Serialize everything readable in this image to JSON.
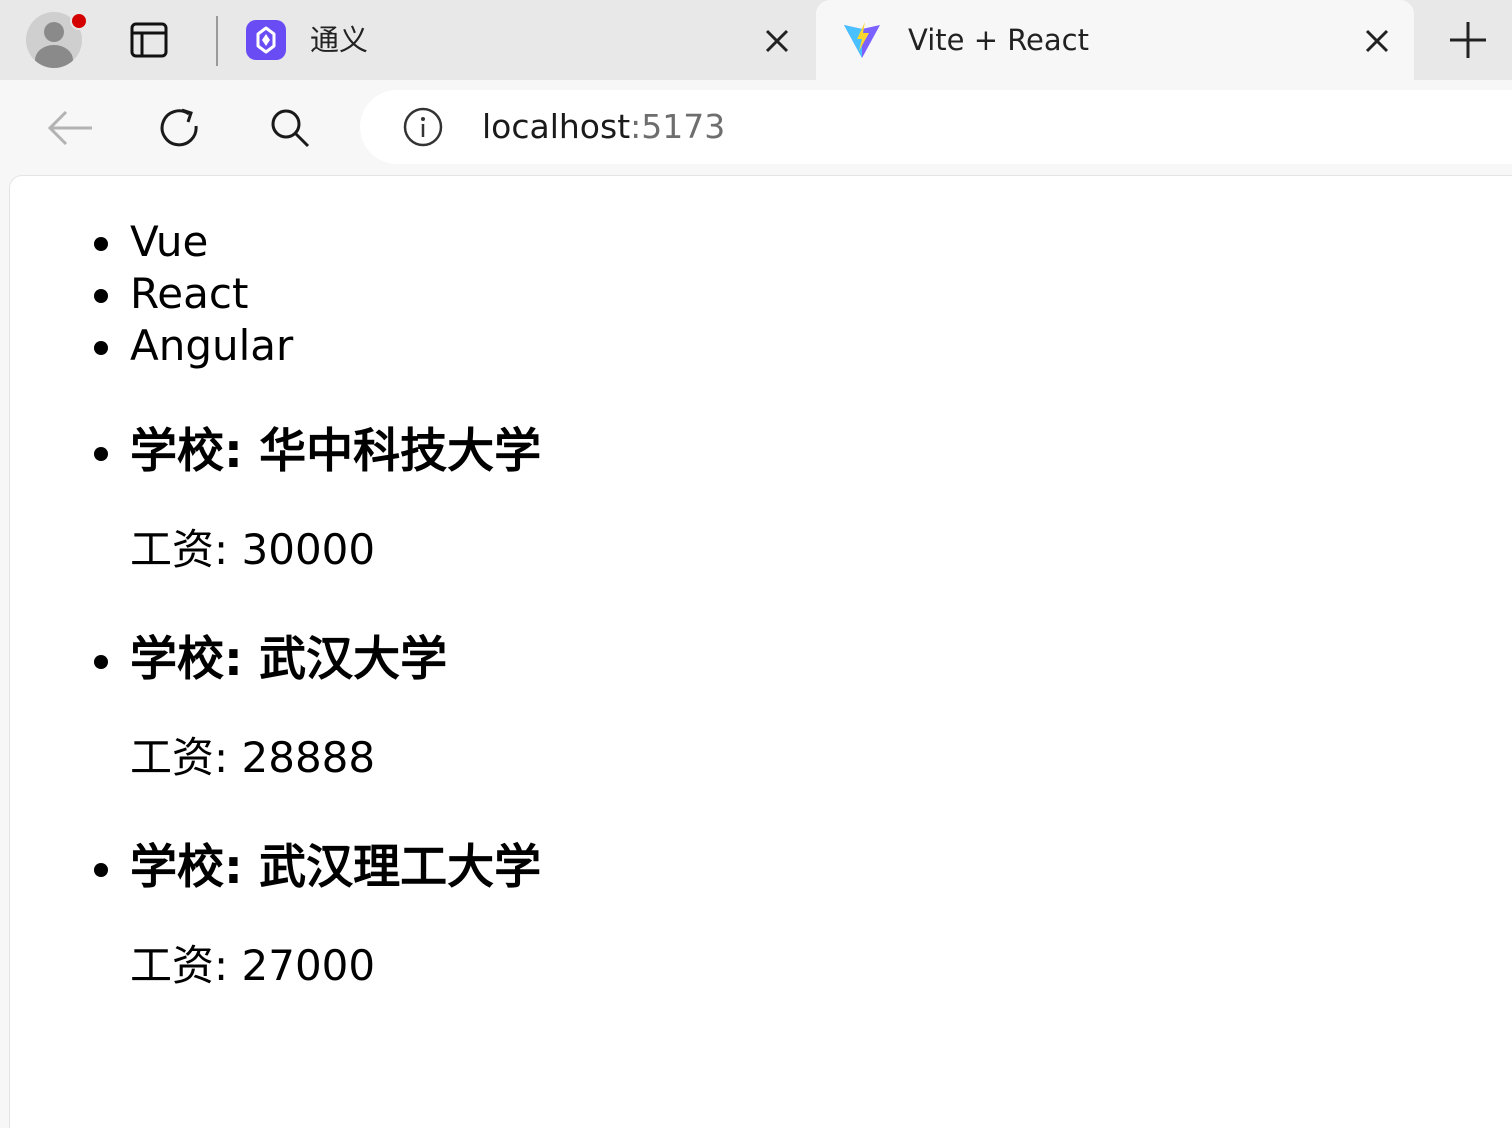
{
  "browser": {
    "tabs": [
      {
        "title": "通义",
        "favicon": "tongyi-logo"
      },
      {
        "title": "Vite + React",
        "favicon": "vite-logo",
        "active": true
      }
    ],
    "address": {
      "host": "localhost",
      "port": ":5173"
    }
  },
  "page": {
    "frameworks": [
      "Vue",
      "React",
      "Angular"
    ],
    "schools": [
      {
        "label": "学校: 华中科技大学",
        "salary": "工资: 30000"
      },
      {
        "label": "学校: 武汉大学",
        "salary": "工资: 28888"
      },
      {
        "label": "学校: 武汉理工大学",
        "salary": "工资: 27000"
      }
    ]
  },
  "colors": {
    "tabbar": "#e8e8e8",
    "toolbar": "#f7f7f7",
    "page": "#ffffff",
    "profile_badge": "#d40000"
  }
}
